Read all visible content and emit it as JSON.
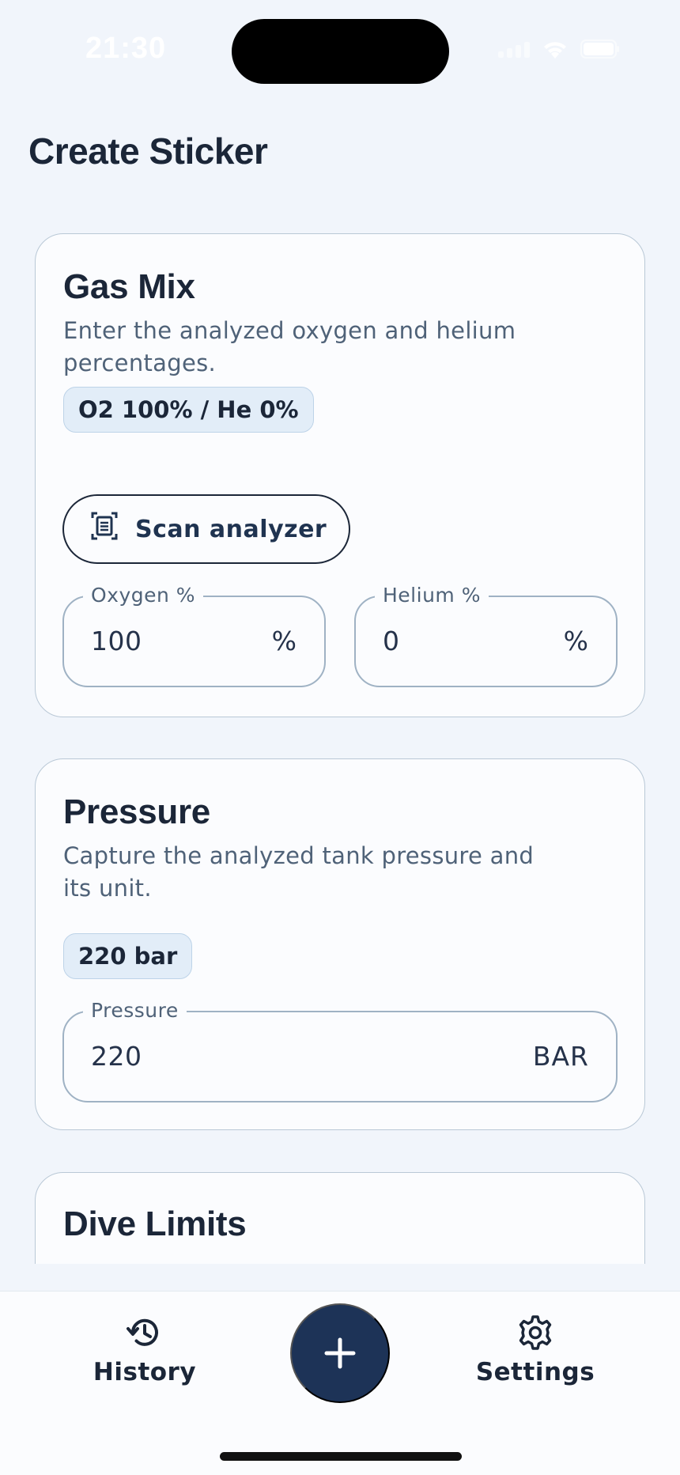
{
  "status_bar": {
    "time": "21:30"
  },
  "page": {
    "title": "Create Sticker"
  },
  "gas_mix": {
    "title": "Gas Mix",
    "description": "Enter the analyzed oxygen and helium percentages.",
    "summary_chip": "O2 100% / He 0%",
    "scan_button_label": "Scan analyzer",
    "scan_icon": "document-scan-icon",
    "oxygen": {
      "label": "Oxygen %",
      "value": "100",
      "unit": "%"
    },
    "helium": {
      "label": "Helium %",
      "value": "0",
      "unit": "%"
    }
  },
  "pressure": {
    "title": "Pressure",
    "description": "Capture the analyzed tank pressure and its unit.",
    "summary_chip": "220 bar",
    "field": {
      "label": "Pressure",
      "value": "220",
      "unit": "BAR"
    }
  },
  "dive_limits": {
    "title": "Dive Limits"
  },
  "tab_bar": {
    "history": {
      "label": "History",
      "icon": "history-icon"
    },
    "add": {
      "icon": "plus-icon"
    },
    "settings": {
      "label": "Settings",
      "icon": "gear-icon"
    }
  },
  "colors": {
    "background": "#f1f5fb",
    "card": "#fbfcfe",
    "accent": "#1d3357",
    "chip": "#e2edf8",
    "text_primary": "#1b2638",
    "text_secondary": "#4f6278"
  }
}
